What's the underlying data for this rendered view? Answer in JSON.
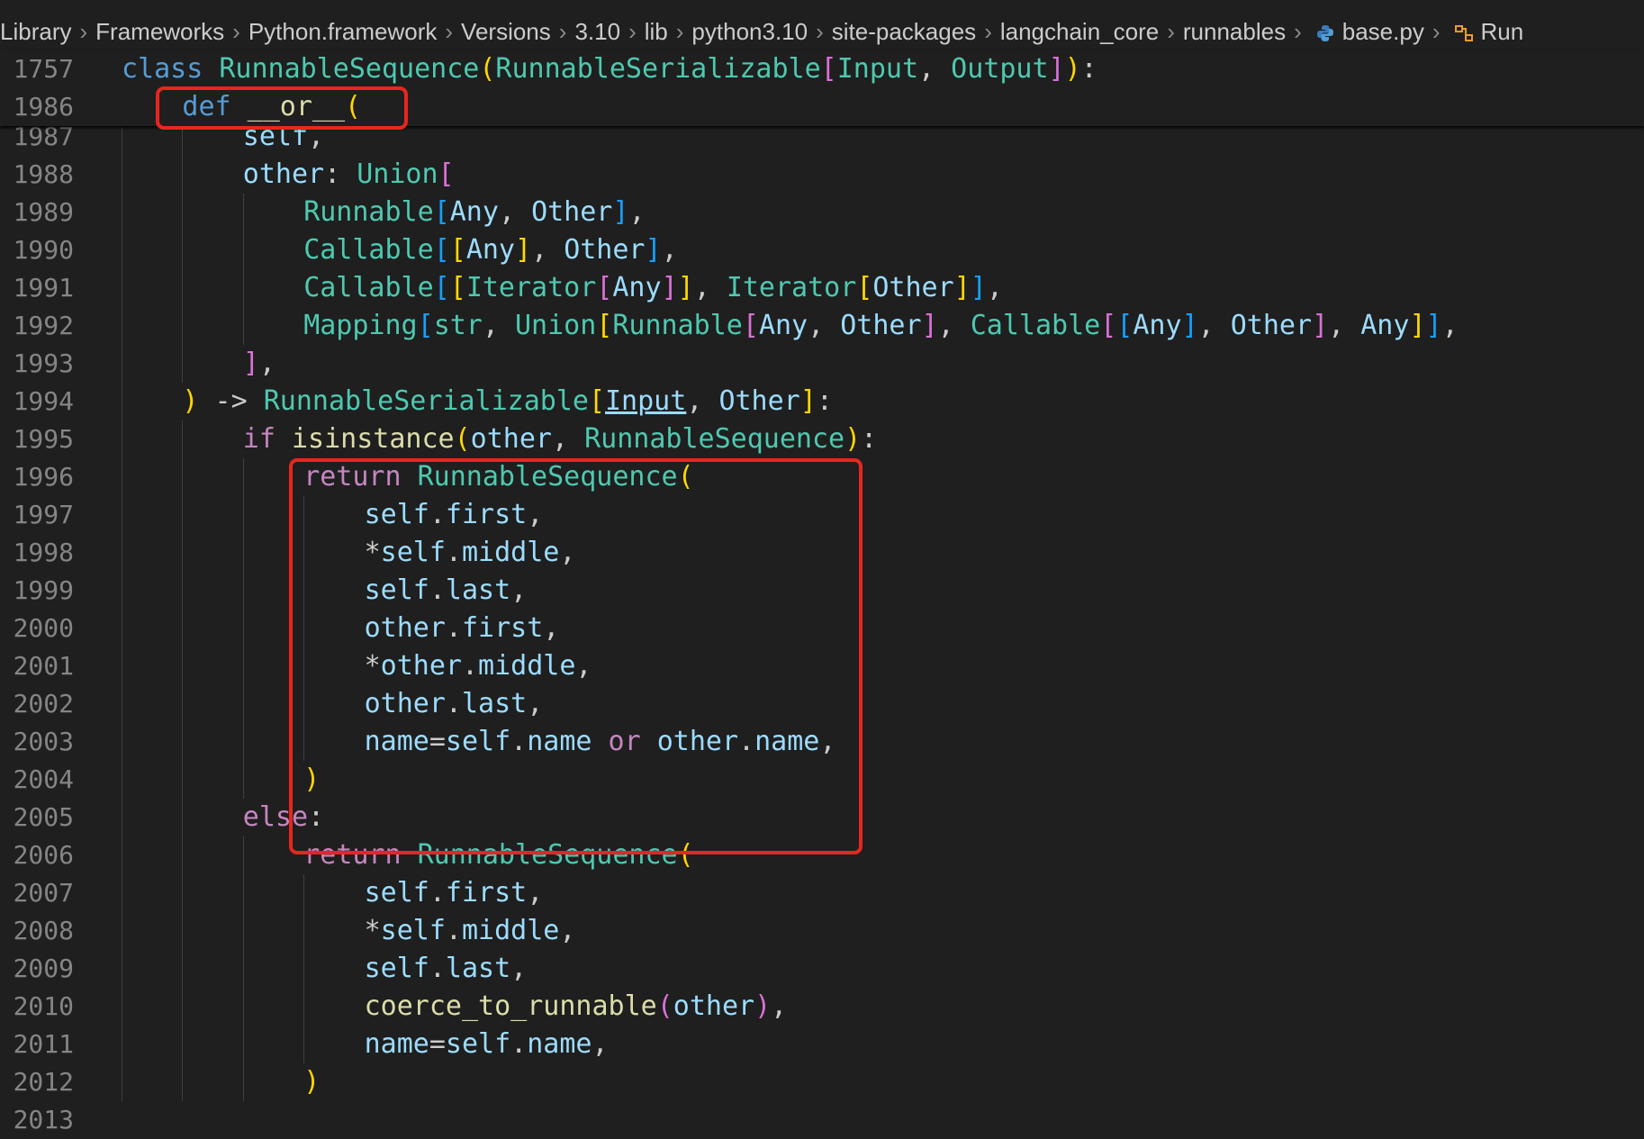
{
  "breadcrumb": {
    "items": [
      "Library",
      "Frameworks",
      "Python.framework",
      "Versions",
      "3.10",
      "lib",
      "python3.10",
      "site-packages",
      "langchain_core",
      "runnables",
      "base.py",
      "Run"
    ],
    "icons": {
      "base.py": "python-file-icon",
      "Run": "symbol-class-icon"
    }
  },
  "editor": {
    "sticky": [
      {
        "num": "1757",
        "indent": 0,
        "tokens": [
          [
            "class",
            "kw"
          ],
          [
            " ",
            "pun"
          ],
          [
            "RunnableSequence",
            "cls"
          ],
          [
            "(",
            "b1"
          ],
          [
            "RunnableSerializable",
            "cls"
          ],
          [
            "[",
            "b2"
          ],
          [
            "Input",
            "cls"
          ],
          [
            ", ",
            "pun"
          ],
          [
            "Output",
            "cls"
          ],
          [
            "]",
            "b2"
          ],
          [
            ")",
            "b1"
          ],
          [
            ":",
            "pun"
          ]
        ]
      },
      {
        "num": "1986",
        "indent": 4,
        "tokens": [
          [
            "def",
            "kw"
          ],
          [
            " ",
            "pun"
          ],
          [
            "__or__",
            "fn"
          ],
          [
            "(",
            "b1"
          ]
        ]
      }
    ],
    "lines": [
      {
        "num": "1987",
        "indent": 8,
        "tokens": [
          [
            "self",
            "var"
          ],
          [
            ",",
            "pun"
          ]
        ]
      },
      {
        "num": "1988",
        "indent": 8,
        "tokens": [
          [
            "other",
            "var"
          ],
          [
            ": ",
            "pun"
          ],
          [
            "Union",
            "cls"
          ],
          [
            "[",
            "b2"
          ]
        ]
      },
      {
        "num": "1989",
        "indent": 12,
        "tokens": [
          [
            "Runnable",
            "cls"
          ],
          [
            "[",
            "b3"
          ],
          [
            "Any",
            "var"
          ],
          [
            ", ",
            "pun"
          ],
          [
            "Other",
            "var"
          ],
          [
            "]",
            "b3"
          ],
          [
            ",",
            "pun"
          ]
        ]
      },
      {
        "num": "1990",
        "indent": 12,
        "tokens": [
          [
            "Callable",
            "cls"
          ],
          [
            "[",
            "b3"
          ],
          [
            "[",
            "b1"
          ],
          [
            "Any",
            "var"
          ],
          [
            "]",
            "b1"
          ],
          [
            ", ",
            "pun"
          ],
          [
            "Other",
            "var"
          ],
          [
            "]",
            "b3"
          ],
          [
            ",",
            "pun"
          ]
        ]
      },
      {
        "num": "1991",
        "indent": 12,
        "tokens": [
          [
            "Callable",
            "cls"
          ],
          [
            "[",
            "b3"
          ],
          [
            "[",
            "b1"
          ],
          [
            "Iterator",
            "cls"
          ],
          [
            "[",
            "b2"
          ],
          [
            "Any",
            "var"
          ],
          [
            "]",
            "b2"
          ],
          [
            "]",
            "b1"
          ],
          [
            ", ",
            "pun"
          ],
          [
            "Iterator",
            "cls"
          ],
          [
            "[",
            "b1"
          ],
          [
            "Other",
            "var"
          ],
          [
            "]",
            "b1"
          ],
          [
            "]",
            "b3"
          ],
          [
            ",",
            "pun"
          ]
        ]
      },
      {
        "num": "1992",
        "indent": 12,
        "tokens": [
          [
            "Mapping",
            "cls"
          ],
          [
            "[",
            "b3"
          ],
          [
            "str",
            "cls"
          ],
          [
            ", ",
            "pun"
          ],
          [
            "Union",
            "cls"
          ],
          [
            "[",
            "b1"
          ],
          [
            "Runnable",
            "cls"
          ],
          [
            "[",
            "b2"
          ],
          [
            "Any",
            "var"
          ],
          [
            ", ",
            "pun"
          ],
          [
            "Other",
            "var"
          ],
          [
            "]",
            "b2"
          ],
          [
            ", ",
            "pun"
          ],
          [
            "Callable",
            "cls"
          ],
          [
            "[",
            "b2"
          ],
          [
            "[",
            "b3"
          ],
          [
            "Any",
            "var"
          ],
          [
            "]",
            "b3"
          ],
          [
            ", ",
            "pun"
          ],
          [
            "Other",
            "var"
          ],
          [
            "]",
            "b2"
          ],
          [
            ", ",
            "pun"
          ],
          [
            "Any",
            "var"
          ],
          [
            "]",
            "b1"
          ],
          [
            "]",
            "b3"
          ],
          [
            ",",
            "pun"
          ]
        ]
      },
      {
        "num": "1993",
        "indent": 8,
        "tokens": [
          [
            "]",
            "b2"
          ],
          [
            ",",
            "pun"
          ]
        ]
      },
      {
        "num": "1994",
        "indent": 4,
        "tokens": [
          [
            ")",
            "b1"
          ],
          [
            " -> ",
            "pun"
          ],
          [
            "RunnableSerializable",
            "cls"
          ],
          [
            "[",
            "b1"
          ],
          [
            "Input",
            "link"
          ],
          [
            ", ",
            "pun"
          ],
          [
            "Other",
            "var"
          ],
          [
            "]",
            "b1"
          ],
          [
            ":",
            "pun"
          ]
        ]
      },
      {
        "num": "1995",
        "indent": 8,
        "tokens": [
          [
            "if",
            "ctl"
          ],
          [
            " ",
            "pun"
          ],
          [
            "isinstance",
            "fn"
          ],
          [
            "(",
            "b1"
          ],
          [
            "other",
            "var"
          ],
          [
            ", ",
            "pun"
          ],
          [
            "RunnableSequence",
            "cls"
          ],
          [
            ")",
            "b1"
          ],
          [
            ":",
            "pun"
          ]
        ]
      },
      {
        "num": "1996",
        "indent": 12,
        "tokens": [
          [
            "return",
            "ctl"
          ],
          [
            " ",
            "pun"
          ],
          [
            "RunnableSequence",
            "cls"
          ],
          [
            "(",
            "b1"
          ]
        ]
      },
      {
        "num": "1997",
        "indent": 16,
        "tokens": [
          [
            "self",
            "var"
          ],
          [
            ".",
            "pun"
          ],
          [
            "first",
            "var"
          ],
          [
            ",",
            "pun"
          ]
        ]
      },
      {
        "num": "1998",
        "indent": 16,
        "tokens": [
          [
            "*",
            "pun"
          ],
          [
            "self",
            "var"
          ],
          [
            ".",
            "pun"
          ],
          [
            "middle",
            "var"
          ],
          [
            ",",
            "pun"
          ]
        ]
      },
      {
        "num": "1999",
        "indent": 16,
        "tokens": [
          [
            "self",
            "var"
          ],
          [
            ".",
            "pun"
          ],
          [
            "last",
            "var"
          ],
          [
            ",",
            "pun"
          ]
        ]
      },
      {
        "num": "2000",
        "indent": 16,
        "tokens": [
          [
            "other",
            "var"
          ],
          [
            ".",
            "pun"
          ],
          [
            "first",
            "var"
          ],
          [
            ",",
            "pun"
          ]
        ]
      },
      {
        "num": "2001",
        "indent": 16,
        "tokens": [
          [
            "*",
            "pun"
          ],
          [
            "other",
            "var"
          ],
          [
            ".",
            "pun"
          ],
          [
            "middle",
            "var"
          ],
          [
            ",",
            "pun"
          ]
        ]
      },
      {
        "num": "2002",
        "indent": 16,
        "tokens": [
          [
            "other",
            "var"
          ],
          [
            ".",
            "pun"
          ],
          [
            "last",
            "var"
          ],
          [
            ",",
            "pun"
          ]
        ]
      },
      {
        "num": "2003",
        "indent": 16,
        "tokens": [
          [
            "name",
            "var"
          ],
          [
            "=",
            "pun"
          ],
          [
            "self",
            "var"
          ],
          [
            ".",
            "pun"
          ],
          [
            "name",
            "var"
          ],
          [
            " ",
            "pun"
          ],
          [
            "or",
            "ctl"
          ],
          [
            " ",
            "pun"
          ],
          [
            "other",
            "var"
          ],
          [
            ".",
            "pun"
          ],
          [
            "name",
            "var"
          ],
          [
            ",",
            "pun"
          ]
        ]
      },
      {
        "num": "2004",
        "indent": 12,
        "tokens": [
          [
            ")",
            "b1"
          ]
        ]
      },
      {
        "num": "2005",
        "indent": 8,
        "tokens": [
          [
            "else",
            "ctl"
          ],
          [
            ":",
            "pun"
          ]
        ]
      },
      {
        "num": "2006",
        "indent": 12,
        "tokens": [
          [
            "return",
            "ctl"
          ],
          [
            " ",
            "pun"
          ],
          [
            "RunnableSequence",
            "cls"
          ],
          [
            "(",
            "b1"
          ]
        ]
      },
      {
        "num": "2007",
        "indent": 16,
        "tokens": [
          [
            "self",
            "var"
          ],
          [
            ".",
            "pun"
          ],
          [
            "first",
            "var"
          ],
          [
            ",",
            "pun"
          ]
        ]
      },
      {
        "num": "2008",
        "indent": 16,
        "tokens": [
          [
            "*",
            "pun"
          ],
          [
            "self",
            "var"
          ],
          [
            ".",
            "pun"
          ],
          [
            "middle",
            "var"
          ],
          [
            ",",
            "pun"
          ]
        ]
      },
      {
        "num": "2009",
        "indent": 16,
        "tokens": [
          [
            "self",
            "var"
          ],
          [
            ".",
            "pun"
          ],
          [
            "last",
            "var"
          ],
          [
            ",",
            "pun"
          ]
        ]
      },
      {
        "num": "2010",
        "indent": 16,
        "tokens": [
          [
            "coerce_to_runnable",
            "fn"
          ],
          [
            "(",
            "b2"
          ],
          [
            "other",
            "var"
          ],
          [
            ")",
            "b2"
          ],
          [
            ",",
            "pun"
          ]
        ]
      },
      {
        "num": "2011",
        "indent": 16,
        "tokens": [
          [
            "name",
            "var"
          ],
          [
            "=",
            "pun"
          ],
          [
            "self",
            "var"
          ],
          [
            ".",
            "pun"
          ],
          [
            "name",
            "var"
          ],
          [
            ",",
            "pun"
          ]
        ]
      },
      {
        "num": "2012",
        "indent": 12,
        "tokens": [
          [
            ")",
            "b1"
          ]
        ]
      },
      {
        "num": "2013",
        "indent": 0,
        "tokens": []
      }
    ]
  },
  "colors": {
    "background": "#1f1f1f",
    "highlight_box": "#e8261f",
    "keyword": "#569cd6",
    "control": "#c586c0",
    "class": "#4ec9b0",
    "variable": "#9cdcfe",
    "function": "#dcdcaa",
    "bracket_1": "#ffd700",
    "bracket_2": "#da70d6",
    "bracket_3": "#179fff"
  }
}
